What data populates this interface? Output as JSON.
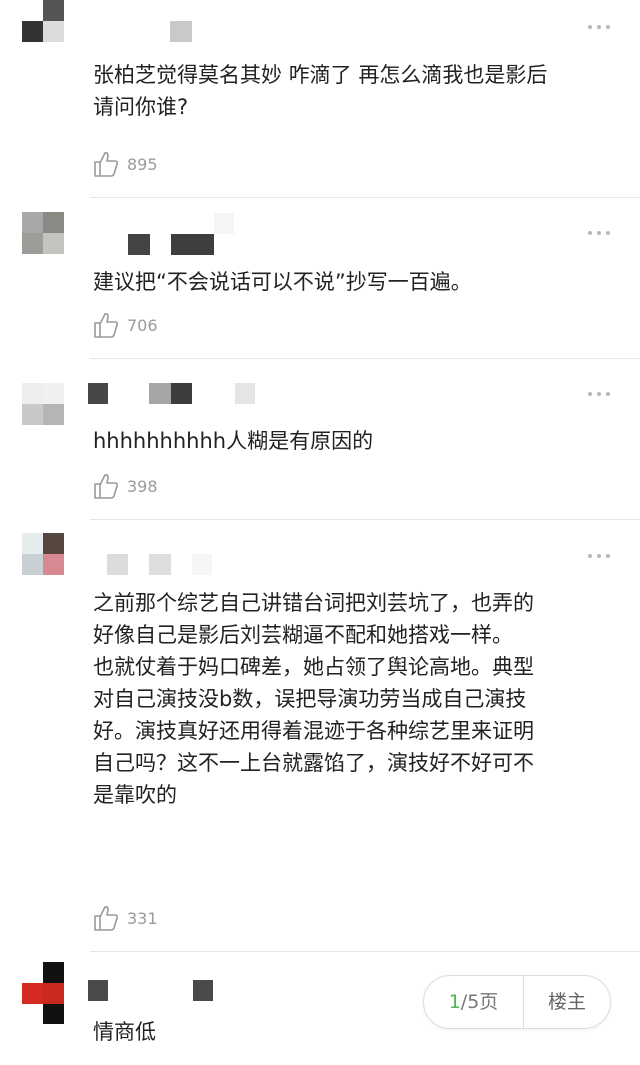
{
  "comments": [
    {
      "text": "张柏芝觉得莫名其妙 咋滴了 再怎么滴我也是影后\n请问你谁?",
      "likes": "895"
    },
    {
      "text": "建议把“不会说话可以不说”抄写一百遍。",
      "likes": "706"
    },
    {
      "text": "hhhhhhhhhh人糊是有原因的",
      "likes": "398"
    },
    {
      "text": "之前那个综艺自己讲错台词把刘芸坑了，也弄的\n好像自己是影后刘芸糊逼不配和她搭戏一样。\n也就仗着于妈口碑差，她占领了舆论高地。典型\n对自己演技没b数，误把导演功劳当成自己演技\n好。演技真好还用得着混迹于各种综艺里来证明\n自己吗？这不一上台就露馅了，演技好不好可不\n是靠吹的",
      "likes": "331"
    },
    {
      "text": "情商低"
    }
  ],
  "icons": {
    "like": "thumbs-up-icon",
    "more": "more-dots-icon"
  },
  "pager": {
    "current": "1",
    "rest": "/5页",
    "owner_label": "楼主"
  },
  "colors": {
    "accent": "#4fb34f",
    "muted": "#9a9a9a",
    "divider": "#e6e6e6"
  }
}
